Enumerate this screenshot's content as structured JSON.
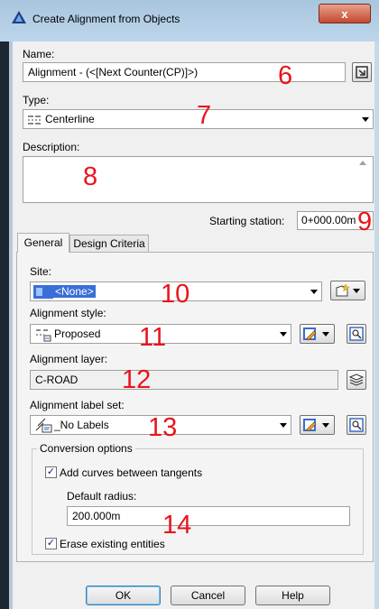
{
  "window": {
    "title": "Create Alignment from Objects",
    "close_glyph": "x"
  },
  "name": {
    "label": "Name:",
    "value": "Alignment - (<[Next Counter(CP)]>)"
  },
  "type": {
    "label": "Type:",
    "value": "Centerline"
  },
  "description": {
    "label": "Description:",
    "value": ""
  },
  "starting_station": {
    "label": "Starting station:",
    "value": "0+000.00m"
  },
  "tabs": [
    {
      "label": "General"
    },
    {
      "label": "Design Criteria"
    }
  ],
  "site": {
    "label": "Site:",
    "value": "<None>"
  },
  "alignment_style": {
    "label": "Alignment style:",
    "value": "Proposed"
  },
  "alignment_layer": {
    "label": "Alignment layer:",
    "value": "C-ROAD"
  },
  "label_set": {
    "label": "Alignment label set:",
    "value": "_No Labels"
  },
  "conversion": {
    "title": "Conversion options",
    "add_curves": {
      "label": "Add curves between tangents",
      "checked": true
    },
    "radius": {
      "label": "Default radius:",
      "value": "200.000m"
    },
    "erase": {
      "label": "Erase existing entities",
      "checked": true
    }
  },
  "buttons": {
    "ok": "OK",
    "cancel": "Cancel",
    "help": "Help"
  },
  "annotations": [
    "6",
    "7",
    "8",
    "9",
    "10",
    "11",
    "12",
    "13",
    "14"
  ]
}
